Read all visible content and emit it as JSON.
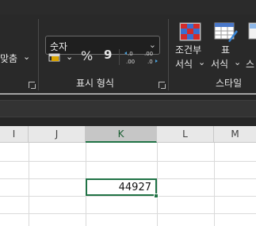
{
  "ribbon": {
    "partial_label": "맞춤",
    "partial_chevron": "⌄",
    "number_format": "숫자",
    "number_format_chevron": "⌄",
    "accounting_chevron": "⌄",
    "percent": "%",
    "comma": "9",
    "increase_decimal": "←.0 .00",
    "decrease_decimal": ".00 →.0",
    "number_group": "표시 형식",
    "conditional_top": "조건부",
    "conditional_bottom": "서식",
    "table_top": "표",
    "table_bottom": "서식",
    "styles_partial": "스",
    "styles_group": "스타일"
  },
  "sheet": {
    "columns": [
      "I",
      "J",
      "K",
      "L",
      "M"
    ],
    "selected_column": "K",
    "active_cell_value": "44927"
  },
  "colors": {
    "accent": "#217346",
    "ribbon_bg": "#292929"
  }
}
